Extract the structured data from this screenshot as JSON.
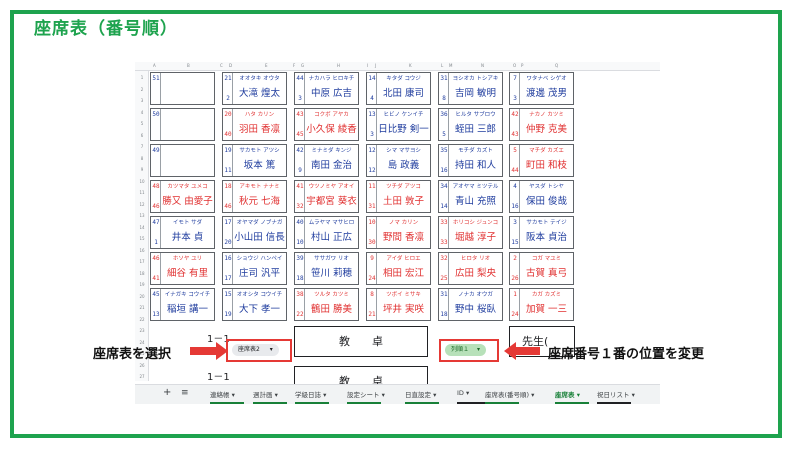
{
  "title": "座席表（番号順）",
  "col_headers": [
    "A",
    "B",
    "C",
    "D",
    "E",
    "F",
    "G",
    "H",
    "I",
    "J",
    "K",
    "L",
    "M",
    "N",
    "O",
    "P",
    "Q"
  ],
  "row_headers": [
    "1",
    "2",
    "3",
    "4",
    "5",
    "6",
    "7",
    "8",
    "9",
    "10",
    "11",
    "12",
    "13",
    "14",
    "15",
    "16",
    "17",
    "18",
    "19",
    "20",
    "21",
    "22",
    "23",
    "24",
    "25",
    "26",
    "27"
  ],
  "seats": [
    [
      {
        "n1": "51",
        "n2": "",
        "kana": "",
        "kanji": "",
        "color": "blue",
        "empty": true
      },
      {
        "n1": "21",
        "n2": "2",
        "kana": "オオタキ オウタ",
        "kanji": "大滝 煌太",
        "color": "blue"
      },
      {
        "n1": "44",
        "n2": "3",
        "kana": "ナカハラ ヒロキチ",
        "kanji": "中原 広吉",
        "color": "blue"
      },
      {
        "n1": "14",
        "n2": "4",
        "kana": "キタダ コウジ",
        "kanji": "北田 康司",
        "color": "blue"
      },
      {
        "n1": "31",
        "n2": "8",
        "kana": "ヨシオカ トシアキ",
        "kanji": "吉岡 敏明",
        "color": "blue"
      },
      {
        "n1": "7",
        "n2": "3",
        "kana": "ワタナベ シゲオ",
        "kanji": "渡邊 茂男",
        "color": "blue"
      }
    ],
    [
      {
        "n1": "50",
        "n2": "",
        "kana": "",
        "kanji": "",
        "color": "blue",
        "empty": true
      },
      {
        "n1": "20",
        "n2": "40",
        "kana": "ハタ カリン",
        "kanji": "羽田 香凛",
        "color": "red"
      },
      {
        "n1": "43",
        "n2": "45",
        "kana": "コクボ アヤカ",
        "kanji": "小久保 綾香",
        "color": "red"
      },
      {
        "n1": "13",
        "n2": "3",
        "kana": "ヒビノ ケンイチ",
        "kanji": "日比野 剣一",
        "color": "blue"
      },
      {
        "n1": "36",
        "n2": "5",
        "kana": "ヒルタ サブロウ",
        "kanji": "蛭田 三郎",
        "color": "blue"
      },
      {
        "n1": "42",
        "n2": "43",
        "kana": "ナカノ カツミ",
        "kanji": "仲野 克美",
        "color": "red"
      }
    ],
    [
      {
        "n1": "49",
        "n2": "",
        "kana": "",
        "kanji": "",
        "color": "blue",
        "empty": true
      },
      {
        "n1": "19",
        "n2": "11",
        "kana": "サカモト アツシ",
        "kanji": "坂本 篤",
        "color": "blue"
      },
      {
        "n1": "42",
        "n2": "9",
        "kana": "ミナミダ キンジ",
        "kanji": "南田 金治",
        "color": "blue"
      },
      {
        "n1": "12",
        "n2": "12",
        "kana": "シマ マサヨシ",
        "kanji": "島 政義",
        "color": "blue"
      },
      {
        "n1": "35",
        "n2": "16",
        "kana": "モチダ カズト",
        "kanji": "持田 和人",
        "color": "blue"
      },
      {
        "n1": "5",
        "n2": "44",
        "kana": "マチダ カズエ",
        "kanji": "町田 和枝",
        "color": "red"
      }
    ],
    [
      {
        "n1": "48",
        "n2": "46",
        "kana": "カツマタ ユメコ",
        "kanji": "勝又 由愛子",
        "color": "red"
      },
      {
        "n1": "18",
        "n2": "46",
        "kana": "アキモト ナナミ",
        "kanji": "秋元 七海",
        "color": "red"
      },
      {
        "n1": "41",
        "n2": "32",
        "kana": "ウツノミヤ アオイ",
        "kanji": "宇都宮 葵衣",
        "color": "red"
      },
      {
        "n1": "11",
        "n2": "31",
        "kana": "ツチダ アツコ",
        "kanji": "土田 敦子",
        "color": "red"
      },
      {
        "n1": "34",
        "n2": "14",
        "kana": "アオヤマ ミツテル",
        "kanji": "青山 充照",
        "color": "blue"
      },
      {
        "n1": "4",
        "n2": "16",
        "kana": "ヤスダ トシヤ",
        "kanji": "保田 俊哉",
        "color": "blue"
      }
    ],
    [
      {
        "n1": "47",
        "n2": "1",
        "kana": "イモト サダ",
        "kanji": "井本 貞",
        "color": "blue"
      },
      {
        "n1": "17",
        "n2": "20",
        "kana": "オヤマダ ノブナガ",
        "kanji": "小山田 信長",
        "color": "blue"
      },
      {
        "n1": "40",
        "n2": "10",
        "kana": "ムラヤマ マサヒロ",
        "kanji": "村山 正広",
        "color": "blue"
      },
      {
        "n1": "10",
        "n2": "30",
        "kana": "ノマ カリン",
        "kanji": "野間 香凛",
        "color": "red"
      },
      {
        "n1": "33",
        "n2": "33",
        "kana": "ホリコシ ジュンコ",
        "kanji": "堀越 淳子",
        "color": "red"
      },
      {
        "n1": "3",
        "n2": "15",
        "kana": "サカモト テイジ",
        "kanji": "阪本 貞治",
        "color": "blue"
      }
    ],
    [
      {
        "n1": "46",
        "n2": "41",
        "kana": "ホソヤ ユリ",
        "kanji": "細谷 有里",
        "color": "red"
      },
      {
        "n1": "16",
        "n2": "17",
        "kana": "ショウジ ハンペイ",
        "kanji": "庄司 汎平",
        "color": "blue"
      },
      {
        "n1": "39",
        "n2": "18",
        "kana": "ササガワ リオ",
        "kanji": "笹川 莉穂",
        "color": "blue"
      },
      {
        "n1": "9",
        "n2": "24",
        "kana": "アイダ ヒロエ",
        "kanji": "相田 宏江",
        "color": "red"
      },
      {
        "n1": "32",
        "n2": "25",
        "kana": "ヒロタ リオ",
        "kanji": "広田 梨央",
        "color": "red"
      },
      {
        "n1": "2",
        "n2": "26",
        "kana": "コガ マユミ",
        "kanji": "古賀 真弓",
        "color": "red"
      }
    ],
    [
      {
        "n1": "45",
        "n2": "13",
        "kana": "イナガキ コウイチ",
        "kanji": "稲垣 講一",
        "color": "blue"
      },
      {
        "n1": "15",
        "n2": "19",
        "kana": "オオシタ コウイチ",
        "kanji": "大下 孝一",
        "color": "blue"
      },
      {
        "n1": "38",
        "n2": "22",
        "kana": "ツルタ カツミ",
        "kanji": "鶴田 勝美",
        "color": "red"
      },
      {
        "n1": "8",
        "n2": "21",
        "kana": "ツボイ ミサキ",
        "kanji": "坪井 実咲",
        "color": "red"
      },
      {
        "n1": "31",
        "n2": "18",
        "kana": "ノナカ オウガ",
        "kanji": "野中 桜臥",
        "color": "blue"
      },
      {
        "n1": "1",
        "n2": "24",
        "kana": "カガ カズミ",
        "kanji": "加賀 一三",
        "color": "red"
      }
    ]
  ],
  "class_label_1": "1－1",
  "class_label_2": "1－1",
  "desk": "教　　卓",
  "desk2": "教　　卓",
  "teacher": "先生(",
  "dropdown_left": "座席表2",
  "dropdown_right": "列順１",
  "callout_left": "座席表を選択",
  "callout_right": "座席番号１番の位置を変更",
  "tabs": [
    {
      "label": "連絡帳",
      "color": "#188038"
    },
    {
      "label": "週計画",
      "color": "#188038"
    },
    {
      "label": "学級日誌",
      "color": "#188038"
    },
    {
      "label": "設定シート",
      "color": "#188038"
    },
    {
      "label": "日直設定",
      "color": "#188038"
    },
    {
      "label": "ID",
      "color": "#202124"
    },
    {
      "label": "座席表(番号順)",
      "color": "#188038"
    },
    {
      "label": "座席表",
      "color": "#188038"
    },
    {
      "label": "祝日リスト",
      "color": "#202124"
    }
  ],
  "add_sheet": "+",
  "menu": "≡",
  "dropdown_arrow": "▾"
}
